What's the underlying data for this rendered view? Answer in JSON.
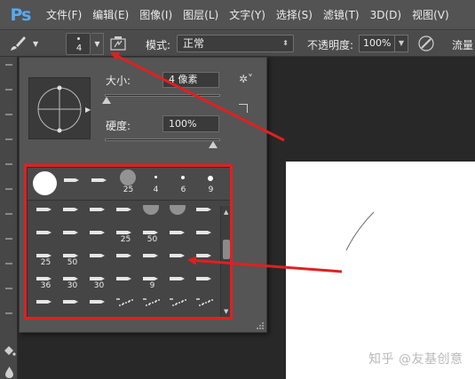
{
  "app": {
    "logo": "Ps"
  },
  "menu": {
    "items": [
      "文件(F)",
      "编辑(E)",
      "图像(I)",
      "图层(L)",
      "文字(Y)",
      "选择(S)",
      "滤镜(T)",
      "3D(D)",
      "视图(V)"
    ]
  },
  "options_bar": {
    "brush_size_preview": "4",
    "mode_label": "模式:",
    "mode_value": "正常",
    "opacity_label": "不透明度:",
    "opacity_value": "100%",
    "flow_label": "流量"
  },
  "brush_popup": {
    "size_label": "大小:",
    "size_value": "4 像素",
    "size_fraction": 0.0,
    "hardness_label": "硬度:",
    "hardness_value": "100%",
    "hardness_fraction": 1.0,
    "recent_presets": [
      "",
      "",
      "",
      "25",
      "4",
      "6",
      "9"
    ],
    "preset_rows": [
      [
        "",
        "",
        "",
        "",
        "",
        "",
        ""
      ],
      [
        "",
        "",
        "",
        "25",
        "50",
        "",
        ""
      ],
      [
        "25",
        "50",
        "",
        "",
        "",
        "",
        ""
      ],
      [
        "36",
        "30",
        "30",
        "",
        "9",
        "",
        ""
      ],
      [
        "",
        "",
        "",
        "",
        "",
        "",
        ""
      ]
    ]
  },
  "watermark": "知乎 @友基创意"
}
